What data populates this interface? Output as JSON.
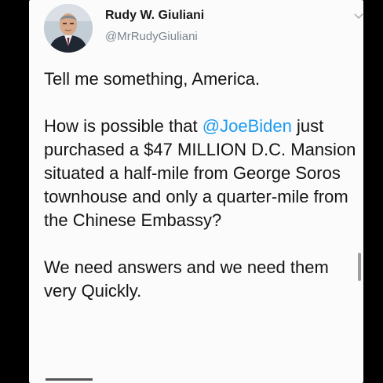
{
  "tweet": {
    "author": {
      "display_name": "Rudy W. Giuliani",
      "handle": "@MrRudyGiuliani",
      "avatar_icon": "profile-photo"
    },
    "menu_icon": "chevron-down-icon",
    "body": {
      "line1": "Tell me something, America.",
      "para2_prefix": "How is possible that ",
      "mention": "@JoeBiden",
      "para2_suffix": " just purchased a $47 MILLION D.C. Mansion situated a half-mile from George Soros townhouse and only a quarter-mile from the Chinese Embassy?",
      "para3": "We need answers and we need them very Quickly."
    }
  },
  "colors": {
    "background": "#000000",
    "card": "#fbfbfb",
    "mention": "#1d9bf0",
    "handle": "#7a8590",
    "text": "#141414"
  }
}
